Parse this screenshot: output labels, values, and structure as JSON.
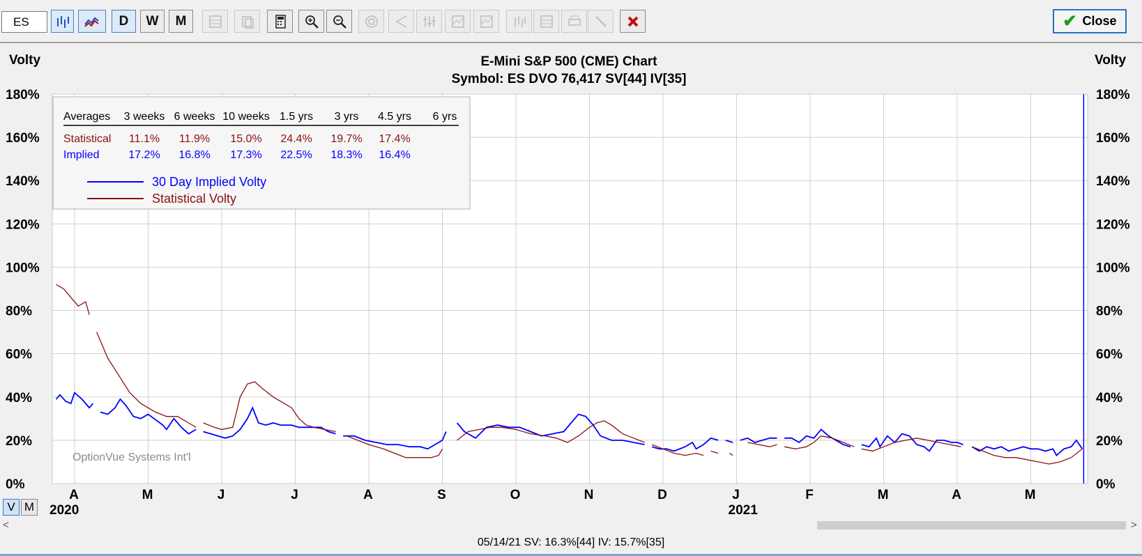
{
  "toolbar": {
    "symbol": "ES",
    "period_buttons": [
      "D",
      "W",
      "M"
    ],
    "close_label": "Close"
  },
  "chart_data": {
    "type": "line",
    "title": "E-Mini S&P 500 (CME) Chart",
    "subtitle": "Symbol: ES  DVO 76,417   SV[44]  IV[35]",
    "ylabel_left": "Volty",
    "ylabel_right": "Volty",
    "ylim": [
      0,
      180
    ],
    "yticks": [
      "0%",
      "20%",
      "40%",
      "60%",
      "80%",
      "100%",
      "120%",
      "140%",
      "160%",
      "180%"
    ],
    "xtick_labels": [
      "A",
      "M",
      "J",
      "J",
      "A",
      "S",
      "O",
      "N",
      "D",
      "J",
      "F",
      "M",
      "A",
      "M"
    ],
    "year_labels": [
      "2020",
      "2021"
    ],
    "watermark": "OptionVue Systems Int'l",
    "legend": [
      {
        "name": "30 Day Implied Volty",
        "color": "#0000ff"
      },
      {
        "name": "Statistical Volty",
        "color": "#8b1010"
      }
    ],
    "averages_table": {
      "headers": [
        "Averages",
        "3 weeks",
        "6 weeks",
        "10 weeks",
        "1.5 yrs",
        "3 yrs",
        "4.5 yrs",
        "6 yrs"
      ],
      "rows": [
        {
          "label": "Statistical",
          "color": "#8b1010",
          "values": [
            "11.1%",
            "11.9%",
            "15.0%",
            "24.4%",
            "19.7%",
            "17.4%",
            ""
          ]
        },
        {
          "label": "Implied",
          "color": "#0000ff",
          "values": [
            "17.2%",
            "16.8%",
            "17.3%",
            "22.5%",
            "18.3%",
            "16.4%",
            ""
          ]
        }
      ]
    },
    "x_range_months": [
      -0.25,
      13.7
    ],
    "series": [
      {
        "name": "30 Day Implied Volty",
        "color": "#0000ff",
        "segments": [
          [
            [
              -0.25,
              39
            ],
            [
              -0.2,
              41
            ],
            [
              -0.12,
              38
            ],
            [
              -0.05,
              37
            ],
            [
              0.0,
              42
            ],
            [
              0.1,
              39
            ],
            [
              0.2,
              35
            ],
            [
              0.25,
              37
            ]
          ],
          [
            [
              0.35,
              33
            ],
            [
              0.45,
              32
            ],
            [
              0.55,
              35
            ],
            [
              0.62,
              39
            ],
            [
              0.7,
              36
            ],
            [
              0.8,
              31
            ],
            [
              0.9,
              30
            ],
            [
              1.0,
              32
            ],
            [
              1.08,
              30
            ],
            [
              1.2,
              27
            ],
            [
              1.25,
              25
            ],
            [
              1.35,
              30
            ],
            [
              1.45,
              26
            ],
            [
              1.55,
              23
            ],
            [
              1.65,
              25
            ]
          ],
          [
            [
              1.75,
              24
            ],
            [
              1.85,
              23
            ],
            [
              1.95,
              22
            ],
            [
              2.05,
              21
            ],
            [
              2.15,
              22
            ],
            [
              2.25,
              25
            ],
            [
              2.35,
              30
            ],
            [
              2.42,
              35
            ],
            [
              2.5,
              28
            ],
            [
              2.6,
              27
            ],
            [
              2.7,
              28
            ],
            [
              2.8,
              27
            ],
            [
              2.95,
              27
            ],
            [
              3.05,
              26
            ],
            [
              3.2,
              26
            ],
            [
              3.35,
              26
            ],
            [
              3.45,
              24
            ],
            [
              3.55,
              23
            ]
          ],
          [
            [
              3.65,
              22
            ],
            [
              3.8,
              22
            ],
            [
              3.95,
              20
            ],
            [
              4.1,
              19
            ],
            [
              4.25,
              18
            ],
            [
              4.4,
              18
            ],
            [
              4.55,
              17
            ],
            [
              4.7,
              17
            ],
            [
              4.8,
              16
            ],
            [
              4.9,
              18
            ],
            [
              5.0,
              20
            ],
            [
              5.05,
              24
            ]
          ],
          [
            [
              5.2,
              28
            ],
            [
              5.3,
              24
            ],
            [
              5.45,
              21
            ],
            [
              5.6,
              26
            ],
            [
              5.75,
              27
            ],
            [
              5.9,
              26
            ],
            [
              6.05,
              26
            ],
            [
              6.2,
              24
            ],
            [
              6.35,
              22
            ],
            [
              6.5,
              23
            ],
            [
              6.65,
              24
            ],
            [
              6.75,
              28
            ],
            [
              6.85,
              32
            ],
            [
              6.95,
              31
            ],
            [
              7.05,
              27
            ],
            [
              7.15,
              22
            ],
            [
              7.3,
              20
            ],
            [
              7.45,
              20
            ],
            [
              7.6,
              19
            ],
            [
              7.75,
              18
            ]
          ],
          [
            [
              7.85,
              17
            ],
            [
              7.95,
              16
            ],
            [
              8.05,
              16
            ],
            [
              8.15,
              15
            ],
            [
              8.3,
              17
            ],
            [
              8.4,
              19
            ],
            [
              8.45,
              16
            ],
            [
              8.55,
              18
            ],
            [
              8.65,
              21
            ],
            [
              8.75,
              20
            ]
          ],
          [
            [
              8.85,
              20
            ],
            [
              8.95,
              19
            ]
          ],
          [
            [
              9.05,
              20
            ],
            [
              9.15,
              21
            ],
            [
              9.25,
              19
            ],
            [
              9.35,
              20
            ],
            [
              9.45,
              21
            ],
            [
              9.55,
              21
            ]
          ],
          [
            [
              9.65,
              21
            ],
            [
              9.75,
              21
            ],
            [
              9.85,
              19
            ],
            [
              9.95,
              22
            ],
            [
              10.05,
              21
            ],
            [
              10.15,
              25
            ],
            [
              10.25,
              22
            ],
            [
              10.35,
              20
            ],
            [
              10.45,
              18
            ],
            [
              10.55,
              17
            ]
          ],
          [
            [
              10.7,
              18
            ],
            [
              10.8,
              17
            ],
            [
              10.9,
              21
            ],
            [
              10.95,
              17
            ],
            [
              11.05,
              22
            ],
            [
              11.15,
              19
            ],
            [
              11.25,
              23
            ],
            [
              11.35,
              22
            ],
            [
              11.45,
              18
            ],
            [
              11.55,
              17
            ],
            [
              11.62,
              15
            ],
            [
              11.72,
              20
            ],
            [
              11.82,
              20
            ],
            [
              11.92,
              19
            ],
            [
              12.0,
              19
            ],
            [
              12.08,
              18
            ]
          ],
          [
            [
              12.2,
              17
            ],
            [
              12.3,
              15
            ],
            [
              12.4,
              17
            ],
            [
              12.5,
              16
            ],
            [
              12.6,
              17
            ],
            [
              12.7,
              15
            ],
            [
              12.8,
              16
            ],
            [
              12.9,
              17
            ],
            [
              13.0,
              16
            ],
            [
              13.1,
              16
            ],
            [
              13.2,
              15
            ],
            [
              13.3,
              16
            ],
            [
              13.35,
              13
            ],
            [
              13.45,
              16
            ],
            [
              13.55,
              17
            ],
            [
              13.62,
              20
            ],
            [
              13.7,
              16
            ]
          ]
        ]
      },
      {
        "name": "Statistical Volty",
        "color": "#8b1010",
        "segments": [
          [
            [
              -0.25,
              92
            ],
            [
              -0.15,
              90
            ],
            [
              -0.05,
              86
            ],
            [
              0.05,
              82
            ],
            [
              0.15,
              84
            ],
            [
              0.2,
              78
            ]
          ],
          [
            [
              0.3,
              70
            ],
            [
              0.45,
              58
            ],
            [
              0.6,
              50
            ],
            [
              0.75,
              42
            ],
            [
              0.9,
              37
            ],
            [
              1.0,
              35
            ],
            [
              1.1,
              33
            ],
            [
              1.25,
              31
            ],
            [
              1.4,
              31
            ],
            [
              1.55,
              28
            ],
            [
              1.65,
              26
            ]
          ],
          [
            [
              1.75,
              28
            ],
            [
              1.9,
              26
            ],
            [
              2.0,
              25
            ],
            [
              2.15,
              26
            ],
            [
              2.25,
              40
            ],
            [
              2.35,
              46
            ],
            [
              2.45,
              47
            ],
            [
              2.55,
              44
            ],
            [
              2.7,
              40
            ],
            [
              2.85,
              37
            ],
            [
              2.95,
              35
            ],
            [
              3.05,
              30
            ],
            [
              3.15,
              27
            ],
            [
              3.25,
              26
            ],
            [
              3.4,
              25
            ],
            [
              3.55,
              24
            ]
          ],
          [
            [
              3.7,
              22
            ],
            [
              3.85,
              20
            ],
            [
              4.0,
              18
            ],
            [
              4.2,
              16
            ],
            [
              4.35,
              14
            ],
            [
              4.5,
              12
            ],
            [
              4.7,
              12
            ],
            [
              4.85,
              12
            ],
            [
              4.95,
              13
            ],
            [
              5.0,
              16
            ]
          ],
          [
            [
              5.2,
              20
            ],
            [
              5.35,
              24
            ],
            [
              5.5,
              25
            ],
            [
              5.65,
              26
            ],
            [
              5.8,
              26
            ],
            [
              6.0,
              25
            ],
            [
              6.2,
              23
            ],
            [
              6.4,
              22
            ],
            [
              6.55,
              21
            ],
            [
              6.7,
              19
            ],
            [
              6.85,
              22
            ],
            [
              7.0,
              26
            ],
            [
              7.1,
              28
            ],
            [
              7.2,
              29
            ],
            [
              7.3,
              27
            ],
            [
              7.45,
              23
            ],
            [
              7.6,
              21
            ],
            [
              7.75,
              19
            ]
          ],
          [
            [
              7.85,
              18
            ],
            [
              8.0,
              16
            ],
            [
              8.15,
              14
            ],
            [
              8.3,
              13
            ],
            [
              8.45,
              14
            ],
            [
              8.55,
              13
            ]
          ],
          [
            [
              8.65,
              15
            ],
            [
              8.75,
              14
            ]
          ],
          [
            [
              8.9,
              14
            ],
            [
              8.95,
              13
            ]
          ],
          [
            [
              9.15,
              19
            ],
            [
              9.3,
              18
            ],
            [
              9.45,
              17
            ],
            [
              9.55,
              18
            ]
          ],
          [
            [
              9.65,
              17
            ],
            [
              9.8,
              16
            ],
            [
              9.95,
              17
            ],
            [
              10.05,
              19
            ],
            [
              10.15,
              22
            ],
            [
              10.3,
              21
            ],
            [
              10.45,
              19
            ],
            [
              10.6,
              17
            ]
          ],
          [
            [
              10.7,
              16
            ],
            [
              10.85,
              15
            ],
            [
              11.0,
              17
            ],
            [
              11.15,
              19
            ],
            [
              11.3,
              20
            ],
            [
              11.45,
              21
            ],
            [
              11.6,
              20
            ],
            [
              11.75,
              19
            ],
            [
              11.9,
              18
            ],
            [
              12.05,
              17
            ]
          ],
          [
            [
              12.2,
              17
            ],
            [
              12.35,
              15
            ],
            [
              12.5,
              13
            ],
            [
              12.65,
              12
            ],
            [
              12.8,
              12
            ],
            [
              12.95,
              11
            ],
            [
              13.1,
              10
            ],
            [
              13.25,
              9
            ],
            [
              13.4,
              10
            ],
            [
              13.55,
              12
            ],
            [
              13.7,
              16
            ]
          ]
        ]
      }
    ]
  },
  "status": {
    "text": "05/14/21   SV: 16.3%[44]   IV: 15.7%[35]"
  },
  "view_toggle": [
    "V",
    "M"
  ]
}
